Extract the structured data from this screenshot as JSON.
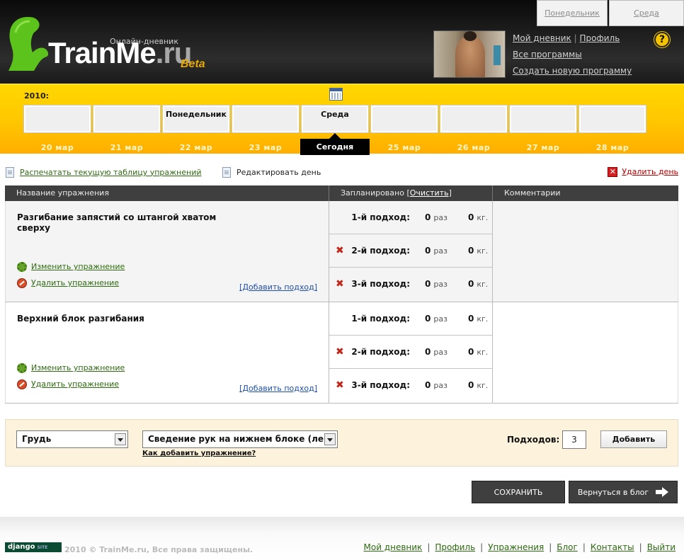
{
  "header": {
    "subtitle": "Онлайн-дневник",
    "logo_main": "TrainMe",
    "logo_ru": ".ru",
    "logo_beta": "Beta",
    "top_tabs": [
      "Понедельник",
      "Среда"
    ],
    "user_links": {
      "my_diary": "Мой дневник",
      "separator": "|",
      "profile": "Профиль",
      "all_programs": "Все программы",
      "create_program": "Создать новую программу"
    },
    "help_label": "?"
  },
  "days": {
    "year": "2010:",
    "boxes": [
      "",
      "",
      "Понедельник",
      "",
      "Среда",
      "",
      "",
      "",
      ""
    ],
    "dates": [
      "20 мар",
      "21 мар",
      "22 мар",
      "23 мар",
      "Сегодня",
      "25 мар",
      "26 мар",
      "27 мар",
      "28 мар"
    ],
    "today_label": "Сегодня"
  },
  "actions": {
    "print": "Распечатать текущую таблицу упражнений",
    "edit": "Редактировать день",
    "delete_day": "Удалить день"
  },
  "table": {
    "col_name": "Название упражнения",
    "col_planned": "Запланировано",
    "clear": "Очистить",
    "col_comments": "Комментарии",
    "exercises": [
      {
        "name": "Разгибание запястий со штангой хватом сверху",
        "edit": "Изменить упражнение",
        "delete": "Удалить упражнение",
        "add_set": "[Добавить подход]",
        "sets": [
          {
            "label": "1-й подход:",
            "reps": "0",
            "reps_unit": "раз",
            "kg": "0",
            "kg_unit": "кг."
          },
          {
            "label": "2-й подход:",
            "reps": "0",
            "reps_unit": "раз",
            "kg": "0",
            "kg_unit": "кг."
          },
          {
            "label": "3-й подход:",
            "reps": "0",
            "reps_unit": "раз",
            "kg": "0",
            "kg_unit": "кг."
          }
        ]
      },
      {
        "name": "Верхний блок разгибания",
        "edit": "Изменить упражнение",
        "delete": "Удалить упражнение",
        "add_set": "[Добавить подход]",
        "sets": [
          {
            "label": "1-й подход:",
            "reps": "0",
            "reps_unit": "раз",
            "kg": "0",
            "kg_unit": "кг."
          },
          {
            "label": "2-й подход:",
            "reps": "0",
            "reps_unit": "раз",
            "kg": "0",
            "kg_unit": "кг."
          },
          {
            "label": "3-й подход:",
            "reps": "0",
            "reps_unit": "раз",
            "kg": "0",
            "kg_unit": "кг."
          }
        ]
      }
    ]
  },
  "add_panel": {
    "muscle_group": "Грудь",
    "exercise": "Сведение рук на нижнем блоке (ле",
    "howto": "Как добавить упражнение?",
    "sets_label": "Подходов:",
    "sets_value": "3",
    "add_button": "Добавить"
  },
  "buttons": {
    "save": "СОХРАНИТЬ",
    "back_to_blog": "Вернуться в блог"
  },
  "footer": {
    "django_badge": "django",
    "django_small": "SITE",
    "copyright": "2010 © TrainMe.ru, Все права защищены.",
    "links": [
      "Мой дневник",
      "Профиль",
      "Упражнения",
      "Блог",
      "Контакты",
      "Выйти"
    ]
  },
  "colors": {
    "accent_yellow": "#ffc800",
    "link_green": "#2d6b0f",
    "header_dark": "#1a1a1a",
    "panel_cream": "#fdf3dc",
    "delete_red": "#b40000"
  }
}
